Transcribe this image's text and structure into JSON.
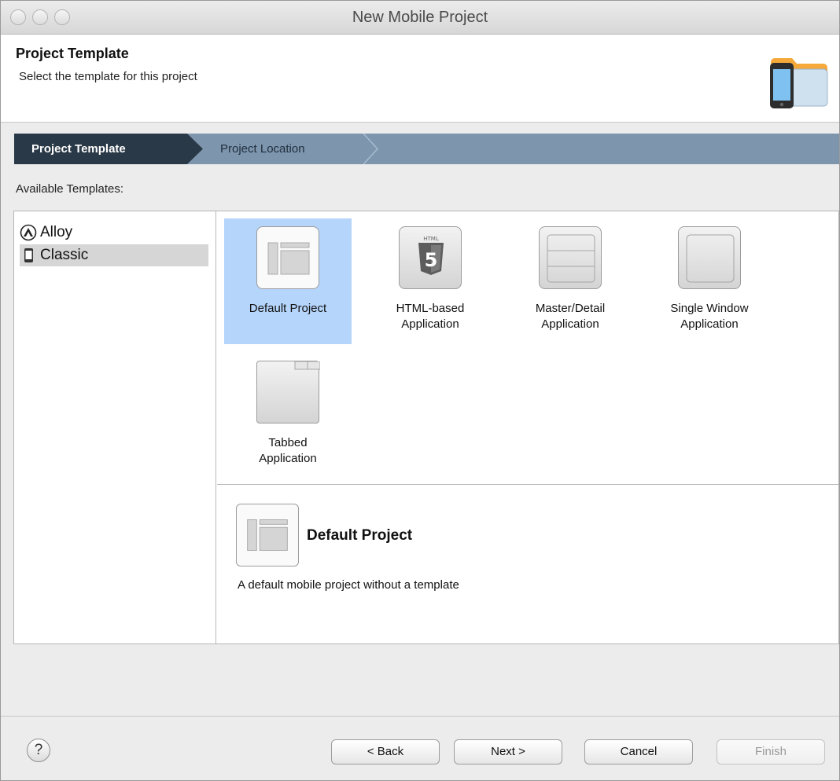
{
  "window": {
    "title": "New Mobile Project"
  },
  "header": {
    "title": "Project Template",
    "subtitle": "Select the template for this project",
    "icon": "mobile-project-folder-icon"
  },
  "steps": [
    {
      "label": "Project Template",
      "active": true
    },
    {
      "label": "Project Location",
      "active": false
    }
  ],
  "available_label": "Available Templates:",
  "categories": [
    {
      "label": "Alloy",
      "icon": "alloy-icon",
      "selected": false
    },
    {
      "label": "Classic",
      "icon": "phone-icon",
      "selected": true
    }
  ],
  "templates": [
    {
      "label": "Default Project",
      "icon": "default-project-icon",
      "selected": true
    },
    {
      "label": "HTML-based Application",
      "icon": "html5-icon",
      "selected": false
    },
    {
      "label": "Master/Detail Application",
      "icon": "master-detail-icon",
      "selected": false
    },
    {
      "label": "Single Window Application",
      "icon": "single-window-icon",
      "selected": false
    },
    {
      "label": "Tabbed Application",
      "icon": "tabbed-icon",
      "selected": false
    }
  ],
  "description": {
    "title": "Default Project",
    "text": "A default mobile project without a template"
  },
  "footer": {
    "help": "?",
    "back": "< Back",
    "next": "Next >",
    "cancel": "Cancel",
    "finish": "Finish"
  },
  "colors": {
    "step_active_bg": "#2a3947",
    "step_bar_bg": "#7d95ad",
    "selection": "#b5d5fb",
    "list_selection": "#d6d6d6"
  }
}
